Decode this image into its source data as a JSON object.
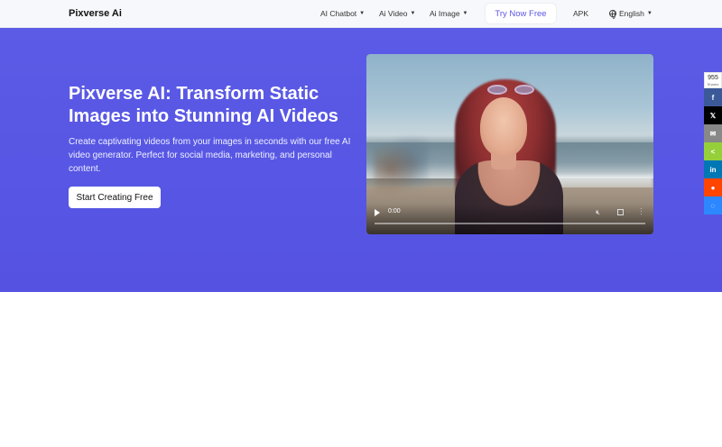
{
  "nav": {
    "brand": "Pixverse Ai",
    "items": [
      {
        "label": "AI Chatbot"
      },
      {
        "label": "Ai Video"
      },
      {
        "label": "Ai Image"
      }
    ],
    "try_button": "Try Now Free",
    "apk": "APK",
    "language": "English"
  },
  "hero": {
    "title": "Pixverse AI: Transform Static Images into Stunning AI Videos",
    "description": "Create captivating videos from your images in seconds with our free AI video generator. Perfect for social media, marketing, and personal content.",
    "cta": "Start Creating Free",
    "video": {
      "time": "0:00",
      "progress": 0
    }
  },
  "share": {
    "count": "955",
    "count_label": "Shares",
    "buttons": [
      {
        "icon": "facebook-icon",
        "glyph": "f",
        "color": "#3b5998"
      },
      {
        "icon": "x-twitter-icon",
        "glyph": "𝕏",
        "color": "#000000"
      },
      {
        "icon": "email-icon",
        "glyph": "✉",
        "color": "#888888"
      },
      {
        "icon": "sharethis-icon",
        "glyph": "<",
        "color": "#95d03a"
      },
      {
        "icon": "linkedin-icon",
        "glyph": "in",
        "color": "#0077b5"
      },
      {
        "icon": "reddit-icon",
        "glyph": "●",
        "color": "#ff4500"
      },
      {
        "icon": "messenger-icon",
        "glyph": "◌",
        "color": "#2d88ff"
      }
    ]
  },
  "colors": {
    "hero_bg": "#5b5be6",
    "accent": "#5b55e6"
  }
}
